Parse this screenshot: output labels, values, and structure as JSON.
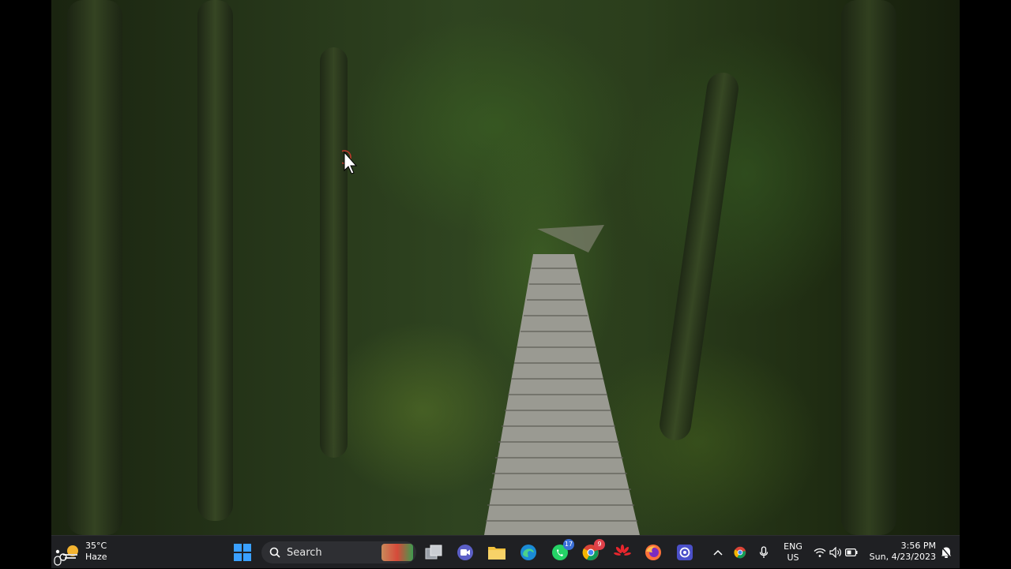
{
  "weather": {
    "temperature": "35°C",
    "condition": "Haze",
    "icon": "sun-haze-icon"
  },
  "search": {
    "label": "Search"
  },
  "taskbar_apps": [
    {
      "name": "start-button",
      "icon": "windows-logo-icon"
    },
    {
      "name": "task-view-button",
      "icon": "task-view-icon"
    },
    {
      "name": "zoom-meetings",
      "icon": "video-chat-icon"
    },
    {
      "name": "file-explorer",
      "icon": "folder-icon"
    },
    {
      "name": "edge-browser",
      "icon": "edge-icon"
    },
    {
      "name": "whatsapp",
      "icon": "whatsapp-icon",
      "badge": "17"
    },
    {
      "name": "chrome",
      "icon": "chrome-icon",
      "badge": "9"
    },
    {
      "name": "huawei-app",
      "icon": "huawei-icon"
    },
    {
      "name": "firefox",
      "icon": "firefox-icon"
    },
    {
      "name": "screen-app",
      "icon": "camera-app-icon"
    }
  ],
  "tray": {
    "language_top": "ENG",
    "language_bottom": "US",
    "time": "3:56 PM",
    "date": "Sun, 4/23/2023"
  },
  "colors": {
    "taskbar_bg": "#1f2023",
    "accent_blue": "#3a6fd8",
    "badge_red": "#e0404a"
  }
}
